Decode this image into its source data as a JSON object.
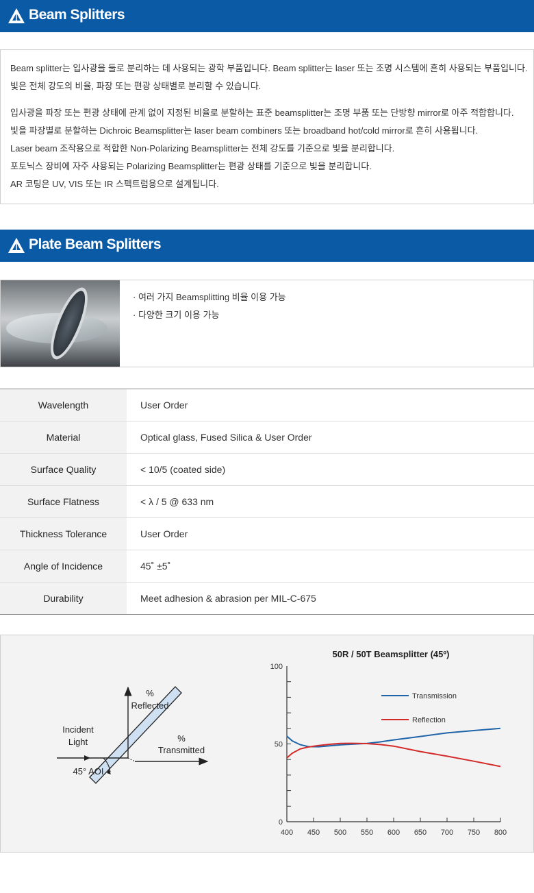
{
  "section1": {
    "title": "Beam Splitters",
    "paragraph1": [
      "Beam splitter는 입사광을 둘로 분리하는 데 사용되는 광학 부품입니다. Beam splitter는 laser 또는 조명 시스템에 흔히 사용되는 부품입니다.",
      "빛은 전체 강도의 비율, 파장 또는 편광 상태별로 분리할 수 있습니다."
    ],
    "paragraph2": [
      "입사광을 파장 또는 편광 상태에 관계 없이 지정된 비율로 분할하는 표준 beamsplitter는 조명 부품 또는 단방향 mirror로 아주 적합합니다.",
      "빛을 파장별로 분할하는 Dichroic Beamsplitter는 laser beam combiners 또는 broadband hot/cold mirror로 흔히 사용됩니다.",
      "Laser beam 조작용으로 적합한 Non-Polarizing Beamsplitter는 전체 강도를 기준으로 빛을 분리합니다.",
      "포토닉스 장비에 자주 사용되는 Polarizing Beamsplitter는 편광 상태를 기준으로 빛을 분리합니다.",
      "AR 코팅은 UV, VIS 또는 IR 스펙트럼용으로 설계됩니다."
    ]
  },
  "section2": {
    "title": "Plate Beam Splitters",
    "bullets": [
      "· 여러 가지 Beamsplitting 비율 이용 가능",
      "· 다양한 크기 이용 가능"
    ]
  },
  "specs": [
    {
      "label": "Wavelength",
      "value": "User Order"
    },
    {
      "label": "Material",
      "value": "Optical glass, Fused Silica & User Order"
    },
    {
      "label": "Surface Quality",
      "value": "< 10/5 (coated side)"
    },
    {
      "label": "Surface Flatness",
      "value": "< λ / 5 @ 633 nm"
    },
    {
      "label": "Thickness Tolerance",
      "value": "User Order"
    },
    {
      "label": "Angle of Incidence",
      "value": "45˚ ±5˚"
    },
    {
      "label": "Durability",
      "value": "Meet adhesion & abrasion per MIL-C-675"
    }
  ],
  "diagram": {
    "incident": [
      "Incident",
      "Light"
    ],
    "aoi": "45° AOI",
    "reflected": [
      "%",
      "Reflected"
    ],
    "transmitted": [
      "%",
      "Transmitted"
    ]
  },
  "chart_data": {
    "type": "line",
    "title": "50R / 50T Beamsplitter (45º)",
    "xlim": [
      400,
      800
    ],
    "ylim": [
      0,
      100
    ],
    "xticks": [
      400,
      450,
      500,
      550,
      600,
      650,
      700,
      750,
      800
    ],
    "yticks": [
      0,
      50,
      100
    ],
    "legend_position": "top-right",
    "grid": false,
    "series": [
      {
        "name": "Transmission",
        "color": "#1f64a8",
        "x": [
          400,
          410,
          425,
          440,
          460,
          480,
          500,
          525,
          550,
          575,
          600,
          650,
          700,
          750,
          800
        ],
        "y": [
          55,
          52,
          49.5,
          48.3,
          48.2,
          48.8,
          49.4,
          49.9,
          50.3,
          51.3,
          52.6,
          54.8,
          57.1,
          58.6,
          60
        ]
      },
      {
        "name": "Reflection",
        "color": "#d42a2a",
        "x": [
          400,
          410,
          425,
          440,
          460,
          480,
          500,
          525,
          550,
          575,
          600,
          650,
          700,
          750,
          800
        ],
        "y": [
          41,
          44,
          46.8,
          48,
          49,
          49.8,
          50.3,
          50.4,
          50.2,
          49.6,
          48.6,
          45.1,
          42.1,
          38.9,
          35.5
        ]
      }
    ]
  }
}
